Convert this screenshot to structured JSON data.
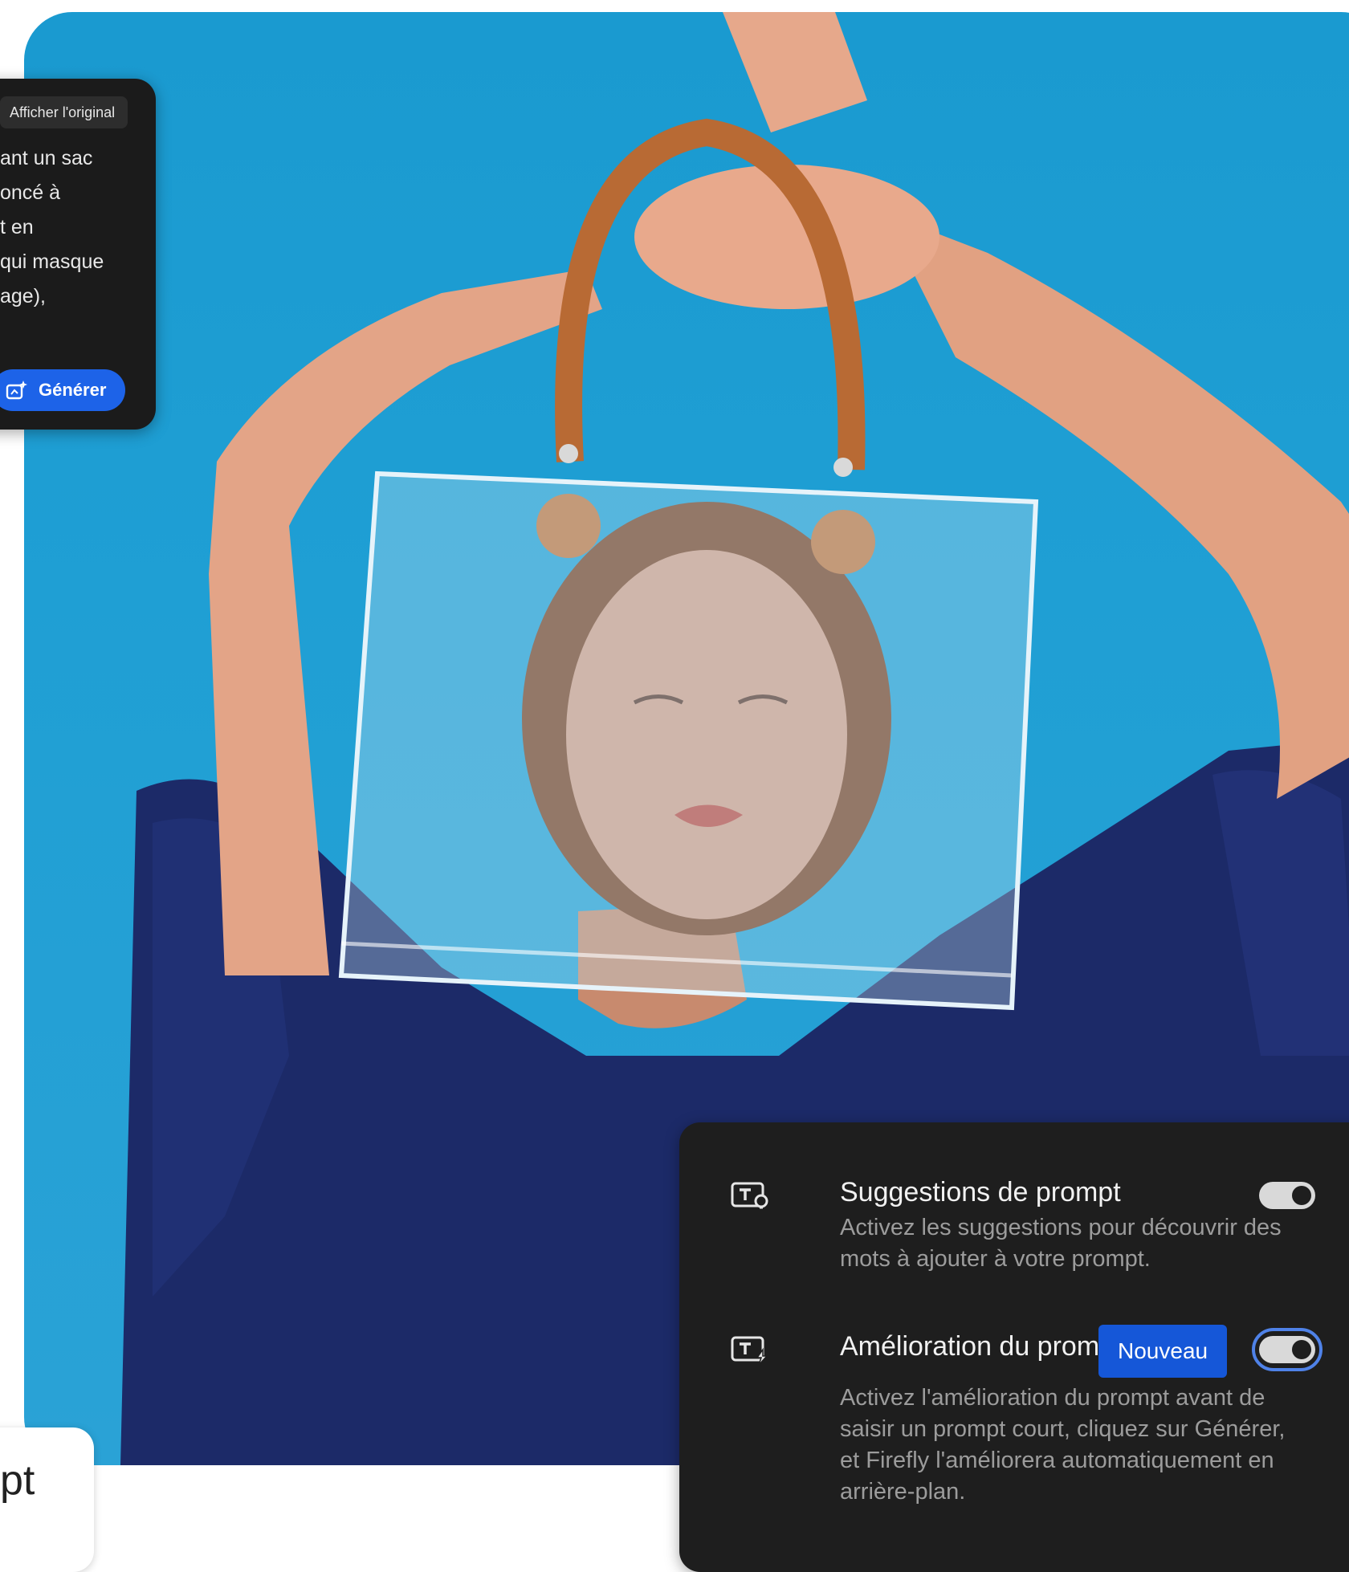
{
  "prompt_panel": {
    "show_original_label": "Afficher l'original",
    "text_lines": [
      "ant un sac",
      "oncé à",
      "t en",
      "qui masque",
      "age),"
    ],
    "generate_label": "Générer"
  },
  "bottom_box": {
    "text": "pt"
  },
  "settings": {
    "prompt_suggestions": {
      "title": "Suggestions de prompt",
      "description": "Activez les suggestions pour découvrir des mots à ajouter à votre prompt.",
      "enabled": true
    },
    "prompt_enhancement": {
      "title": "Amélioration du prompt",
      "badge": "Nouveau",
      "description": "Activez l'amélioration du prompt avant de saisir un prompt court, cliquez sur Générer, et Firefly l'améliorera automatiquement en arrière-plan.",
      "enabled": true
    }
  },
  "colors": {
    "panel_bg": "#1e1e1e",
    "accent_blue": "#1d63e8",
    "sky_blue": "#1f9fd4"
  },
  "icons": {
    "generate": "sparkle-image-icon",
    "suggestions": "text-bulb-icon",
    "enhancement": "text-lightning-icon"
  }
}
